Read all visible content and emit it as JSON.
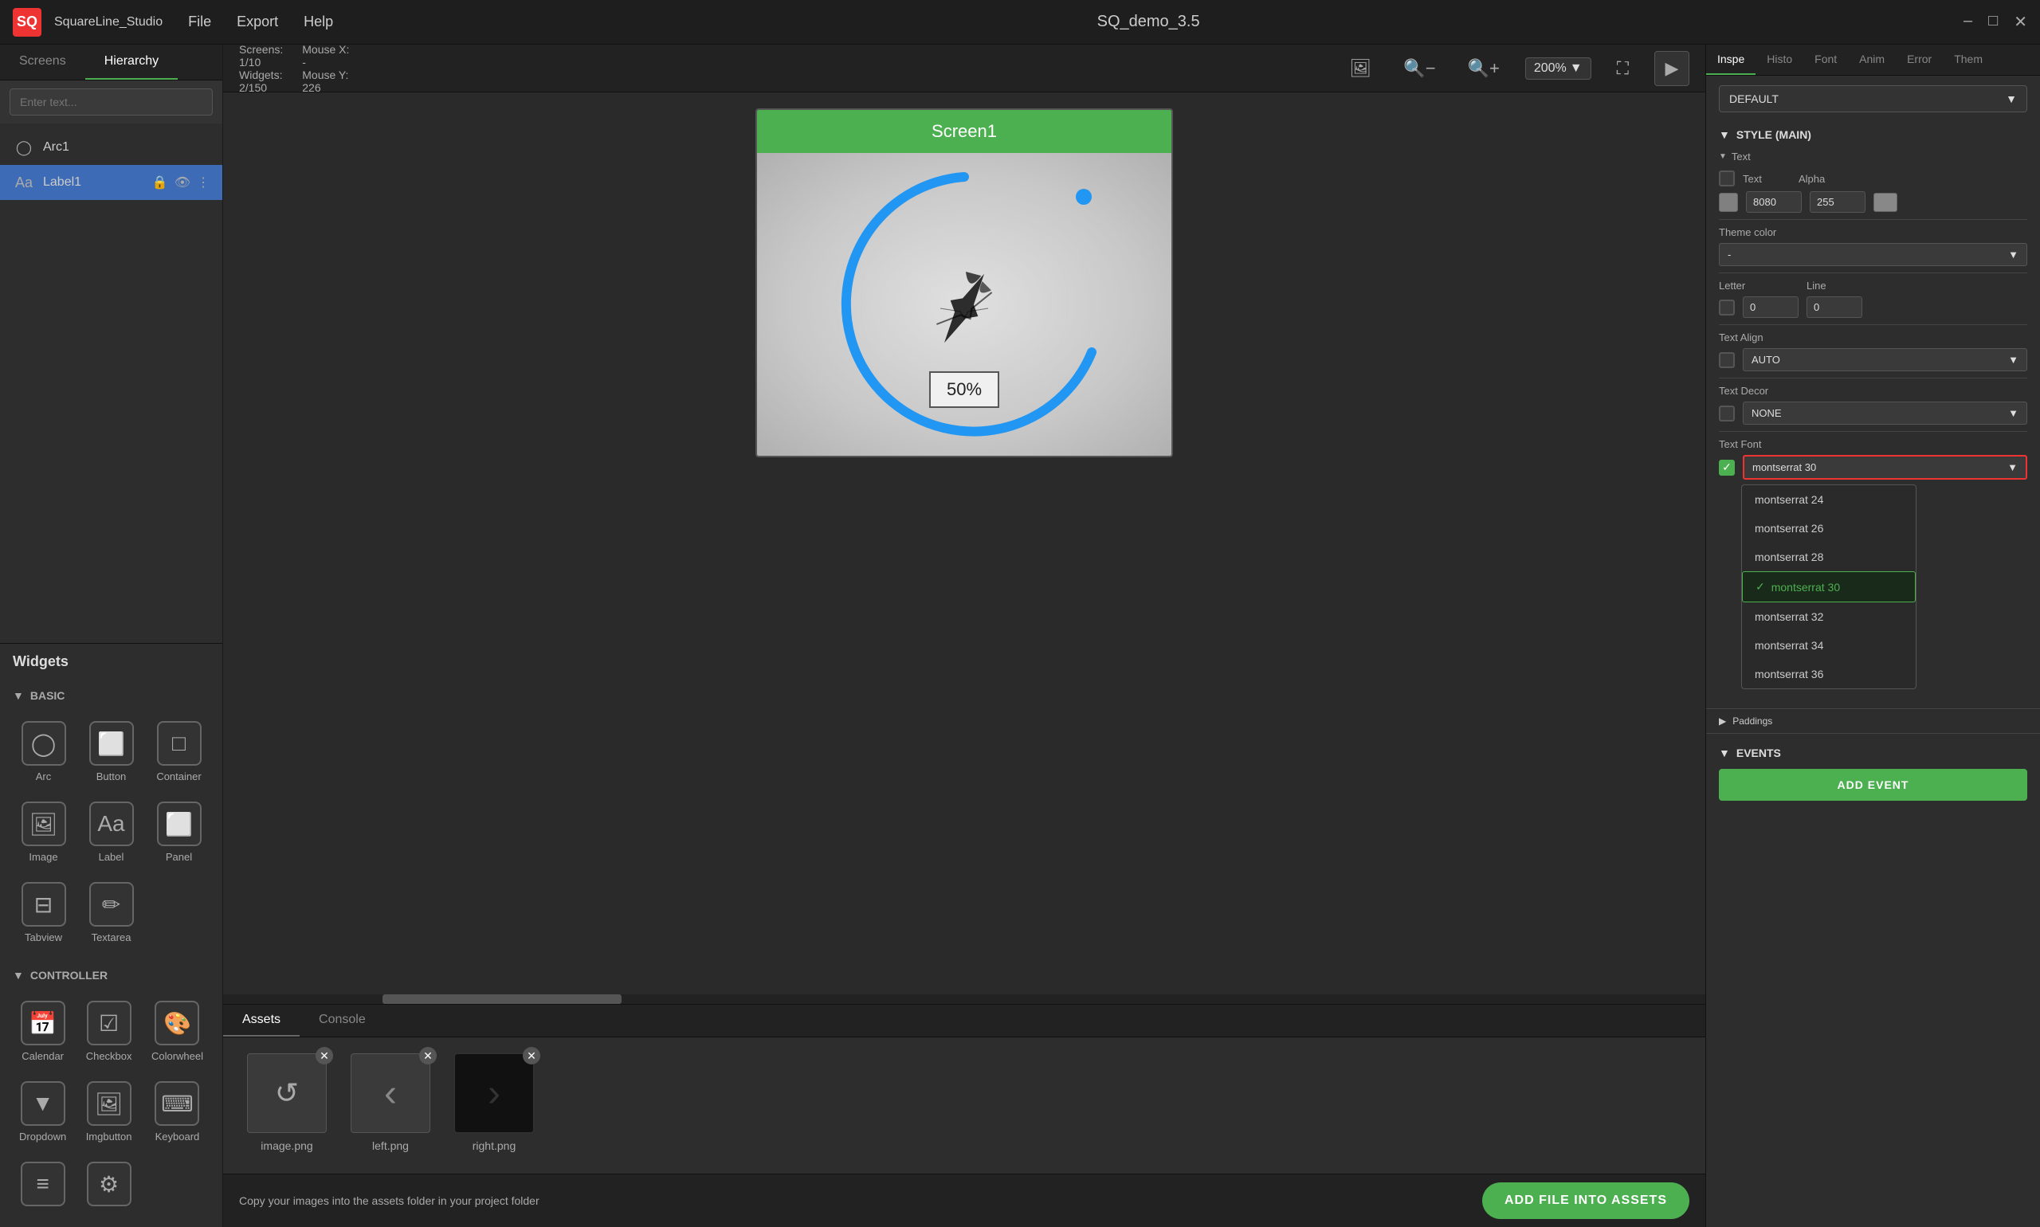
{
  "titlebar": {
    "app_name": "SquareLine_Studio",
    "logo_text": "SQ",
    "menu": [
      "File",
      "Export",
      "Help"
    ],
    "window_title": "SQ_demo_3.5",
    "controls": [
      "–",
      "□",
      "✕"
    ]
  },
  "left": {
    "tabs": [
      "Screens",
      "Hierarchy"
    ],
    "active_tab": "Hierarchy",
    "search_placeholder": "Enter text...",
    "hierarchy_items": [
      {
        "icon": "◯",
        "label": "Arc1",
        "selected": false
      },
      {
        "icon": "Aa",
        "label": "Label1",
        "selected": true
      }
    ],
    "widgets_title": "Widgets",
    "widget_groups": [
      {
        "name": "BASIC",
        "widgets": [
          {
            "icon": "◯",
            "label": "Arc"
          },
          {
            "icon": "⬜",
            "label": "Button"
          },
          {
            "icon": "□",
            "label": "Container"
          },
          {
            "icon": "🖼",
            "label": "Image"
          },
          {
            "icon": "Aa",
            "label": "Label"
          },
          {
            "icon": "⬜",
            "label": "Panel"
          },
          {
            "icon": "⬜",
            "label": "Tabview"
          },
          {
            "icon": "✏",
            "label": "Textarea"
          }
        ]
      },
      {
        "name": "CONTROLLER",
        "widgets": [
          {
            "icon": "📅",
            "label": "Calendar"
          },
          {
            "icon": "☑",
            "label": "Checkbox"
          },
          {
            "icon": "🎨",
            "label": "Colorwheel"
          },
          {
            "icon": "▼",
            "label": "Dropdown"
          },
          {
            "icon": "🖼",
            "label": "Imgbutton"
          },
          {
            "icon": "⌨",
            "label": "Keyboard"
          },
          {
            "icon": "≡",
            "label": "..."
          },
          {
            "icon": "⚙",
            "label": "..."
          }
        ]
      }
    ]
  },
  "toolbar": {
    "screens_label": "Screens:",
    "screens_value": "1/10",
    "widgets_label": "Widgets:",
    "widgets_value": "2/150",
    "mouse_x_label": "Mouse X:",
    "mouse_x_value": "-",
    "mouse_y_label": "Mouse Y:",
    "mouse_y_value": "226",
    "zoom": "200%",
    "zoom_icon": "▼"
  },
  "canvas": {
    "screen_name": "Screen1",
    "label_value": "50%"
  },
  "bottom": {
    "tabs": [
      "Assets",
      "Console"
    ],
    "active_tab": "Assets",
    "assets": [
      {
        "name": "image.png",
        "icon": "↺"
      },
      {
        "name": "left.png",
        "icon": "‹"
      },
      {
        "name": "right.png",
        "icon": "›"
      }
    ],
    "footer_text": "Copy your images into the assets folder in your project folder",
    "add_file_label": "ADD FILE INTO ASSETS"
  },
  "right": {
    "tabs": [
      "Inspe",
      "Histo",
      "Font",
      "Anim",
      "Error",
      "Them"
    ],
    "active_tab": "Inspe",
    "dropdown_value": "DEFAULT",
    "style_main_label": "STYLE (MAIN)",
    "text_section": {
      "label": "Text",
      "text_label": "Text",
      "alpha_label": "Alpha",
      "text_value": "8080",
      "alpha_value": "255",
      "theme_color_label": "Theme color",
      "theme_value": "-",
      "letter_label": "Letter",
      "line_label": "Line",
      "letter_value": "0",
      "line_value": "0",
      "text_align_label": "Text Align",
      "align_value": "AUTO",
      "text_decor_label": "Text Decor",
      "decor_value": "NONE",
      "text_font_label": "Text Font",
      "font_value": "montserrat 30"
    },
    "font_dropdown_items": [
      {
        "label": "montserrat 24",
        "selected": false
      },
      {
        "label": "montserrat 26",
        "selected": false
      },
      {
        "label": "montserrat 28",
        "selected": false
      },
      {
        "label": "montserrat 30",
        "selected": true
      },
      {
        "label": "montserrat 32",
        "selected": false
      },
      {
        "label": "montserrat 34",
        "selected": false
      },
      {
        "label": "montserrat 36",
        "selected": false
      }
    ],
    "paddings_label": "Paddings",
    "events_label": "EVENTS",
    "add_event_label": "ADD EVENT"
  }
}
